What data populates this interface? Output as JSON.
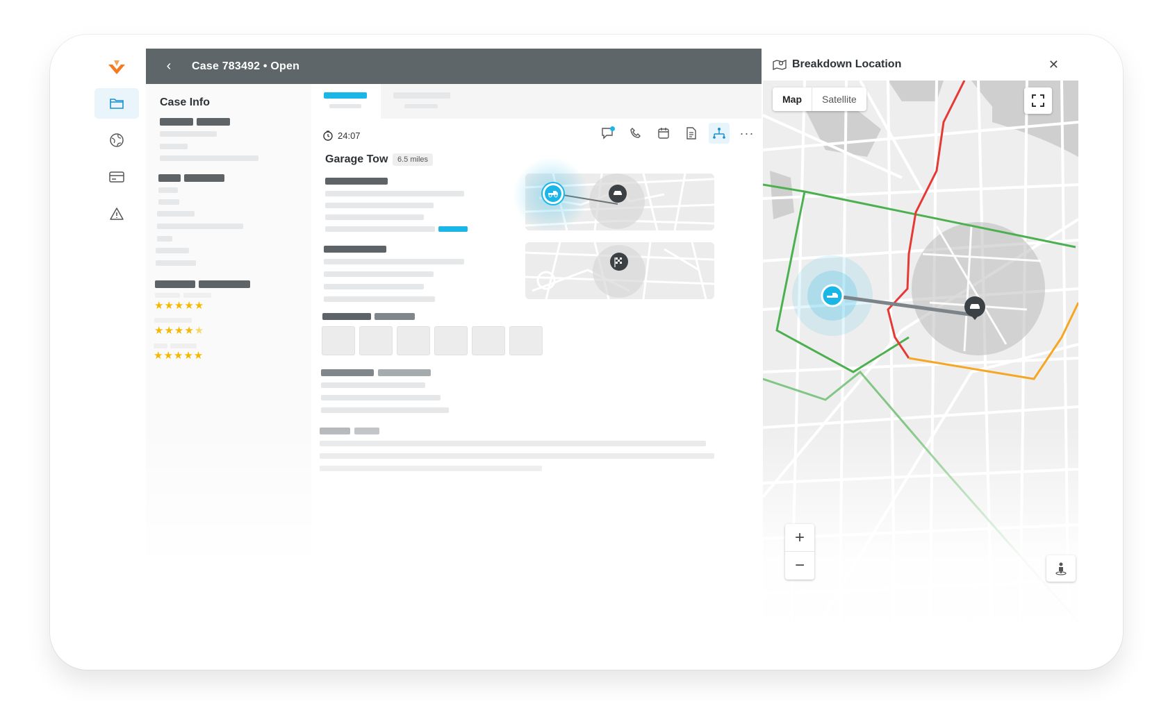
{
  "header": {
    "back_icon": "chevron-left-icon",
    "title": "Case 783492 • Open"
  },
  "sidebar": {
    "items": [
      {
        "icon": "folder-icon",
        "active": true
      },
      {
        "icon": "globe-icon",
        "active": false
      },
      {
        "icon": "credit-card-icon",
        "active": false
      },
      {
        "icon": "warning-icon",
        "active": false
      }
    ]
  },
  "case_info": {
    "title": "Case Info",
    "ratings": [
      5,
      4.5,
      5
    ]
  },
  "detail": {
    "timer": "24:07",
    "service_title": "Garage Tow",
    "distance": "6.5 miles",
    "actions": [
      "chat-icon",
      "phone-icon",
      "calendar-icon",
      "document-icon",
      "route-icon",
      "more-icon"
    ]
  },
  "map_panel": {
    "title": "Breakdown Location",
    "tabs": {
      "map": "Map",
      "satellite": "Satellite",
      "selected": "Map"
    },
    "zoom_in": "+",
    "zoom_out": "−"
  },
  "colors": {
    "accent": "#1ab6e8",
    "topbar": "#5e6669",
    "route_green": "#4caf50",
    "route_red": "#e53935",
    "route_orange": "#f5a623",
    "star": "#f5b800",
    "logo": "#f47b20"
  }
}
